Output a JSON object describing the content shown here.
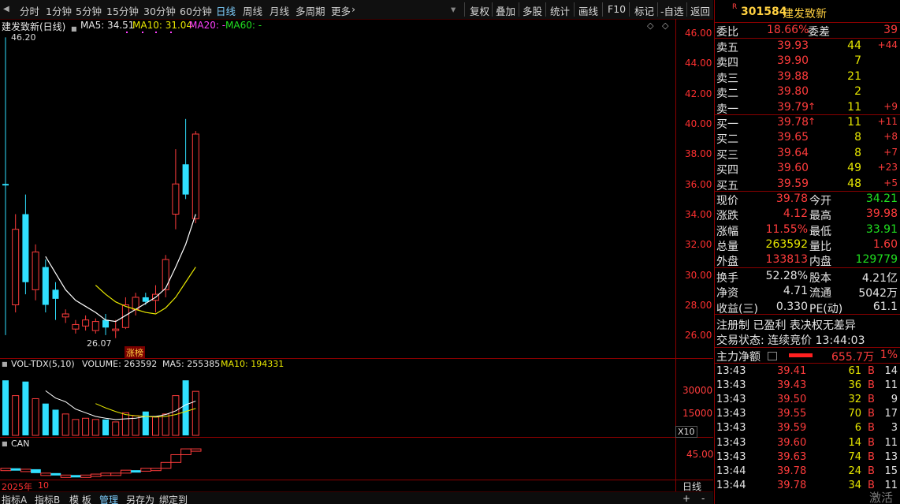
{
  "toolbar": {
    "left_tabs": [
      "分时",
      "1分钟",
      "5分钟",
      "15分钟",
      "30分钟",
      "60分钟",
      "日线",
      "周线",
      "月线",
      "多周期",
      "更多"
    ],
    "active_tab": "日线",
    "right_buttons": [
      "复权",
      "叠加",
      "多股",
      "统计",
      "画线",
      "F10",
      "标记",
      "-自选",
      "返回"
    ]
  },
  "main_chart": {
    "title": "建发致新(日线)",
    "ma5": "MA5: 34.51",
    "ma10": "MA10: 31.04",
    "ma20": "MA20: -",
    "ma60": "MA60: -",
    "high_label": "46.20",
    "low_label": "26.07",
    "badge": "涨榜",
    "y_ticks": [
      "46.00",
      "44.00",
      "42.00",
      "40.00",
      "38.00",
      "36.00",
      "34.00",
      "32.00",
      "30.00",
      "28.00",
      "26.00"
    ]
  },
  "volume_chart": {
    "title": "VOL-TDX(5,10)",
    "volume": "VOLUME: 263592",
    "ma5": "MA5: 255385",
    "ma10": "MA10: 194331",
    "y_ticks": [
      "30000",
      "15000"
    ],
    "unit": "X10"
  },
  "can_chart": {
    "title": "CAN",
    "y_tick": "45.00"
  },
  "time_axis": {
    "year": "2025年",
    "month": "10",
    "period": "日线"
  },
  "bottom_tabs": [
    "指标A",
    "指标B",
    "模 板",
    "管理",
    "另存为",
    "绑定到"
  ],
  "bottom_right": [
    "+",
    "-"
  ],
  "stock": {
    "badge": "R",
    "code": "301584",
    "name": "建发致新"
  },
  "order_book": {
    "wei_bi_label": "委比",
    "wei_bi": "18.66%",
    "wei_cha_label": "委差",
    "wei_cha": "39",
    "sells": [
      {
        "label": "卖五",
        "price": "39.93",
        "vol": "44",
        "chg": "+44"
      },
      {
        "label": "卖四",
        "price": "39.90",
        "vol": "7",
        "chg": ""
      },
      {
        "label": "卖三",
        "price": "39.88",
        "vol": "21",
        "chg": ""
      },
      {
        "label": "卖二",
        "price": "39.80",
        "vol": "2",
        "chg": ""
      },
      {
        "label": "卖一",
        "price": "39.79",
        "vol": "11",
        "chg": "+9",
        "arrow": "↑"
      }
    ],
    "buys": [
      {
        "label": "买一",
        "price": "39.78",
        "vol": "11",
        "chg": "+11",
        "arrow": "↑"
      },
      {
        "label": "买二",
        "price": "39.65",
        "vol": "8",
        "chg": "+8"
      },
      {
        "label": "买三",
        "price": "39.64",
        "vol": "8",
        "chg": "+7"
      },
      {
        "label": "买四",
        "price": "39.60",
        "vol": "49",
        "chg": "+23"
      },
      {
        "label": "买五",
        "price": "39.59",
        "vol": "48",
        "chg": "+5"
      }
    ]
  },
  "quote": [
    {
      "l1": "现价",
      "v1": "39.78",
      "l2": "今开",
      "v2": "34.21",
      "c2": "grn"
    },
    {
      "l1": "涨跌",
      "v1": "4.12",
      "l2": "最高",
      "v2": "39.98",
      "c2": "red"
    },
    {
      "l1": "涨幅",
      "v1": "11.55%",
      "l2": "最低",
      "v2": "33.91",
      "c2": "grn"
    },
    {
      "l1": "总量",
      "v1": "263592",
      "l2": "量比",
      "v2": "1.60",
      "c2": "red",
      "c1": "yel"
    },
    {
      "l1": "外盘",
      "v1": "133813",
      "l2": "内盘",
      "v2": "129779",
      "c2": "grn"
    }
  ],
  "fundamentals": [
    {
      "l1": "换手",
      "v1": "52.28%",
      "l2": "股本",
      "v2": "4.21亿"
    },
    {
      "l1": "净资",
      "v1": "4.71",
      "l2": "流通",
      "v2": "5042万"
    },
    {
      "l1": "收益(三)",
      "v1": "0.330",
      "l2": "PE(动)",
      "v2": "61.1"
    }
  ],
  "info_line": "注册制 已盈利 表决权无差异",
  "trade_status": "交易状态: 连续竞价 13:44:03",
  "main_flow": {
    "label": "主力净额",
    "value": "655.7万",
    "pct": "1%"
  },
  "ticks": [
    {
      "t": "13:43",
      "p": "39.41",
      "v": "61",
      "s": "B",
      "n": "14"
    },
    {
      "t": "13:43",
      "p": "39.43",
      "v": "36",
      "s": "B",
      "n": "11"
    },
    {
      "t": "13:43",
      "p": "39.50",
      "v": "32",
      "s": "B",
      "n": "9"
    },
    {
      "t": "13:43",
      "p": "39.55",
      "v": "70",
      "s": "B",
      "n": "17"
    },
    {
      "t": "13:43",
      "p": "39.59",
      "v": "6",
      "s": "B",
      "n": "3"
    },
    {
      "t": "13:43",
      "p": "39.60",
      "v": "14",
      "s": "B",
      "n": "11"
    },
    {
      "t": "13:43",
      "p": "39.63",
      "v": "74",
      "s": "B",
      "n": "13"
    },
    {
      "t": "13:44",
      "p": "39.78",
      "v": "24",
      "s": "B",
      "n": "15"
    },
    {
      "t": "13:44",
      "p": "39.78",
      "v": "34",
      "s": "B",
      "n": "11"
    }
  ],
  "watermark": "激活",
  "colors": {
    "up": "#ff3c3c",
    "down": "#30e0ff",
    "ma5": "#ffffff",
    "ma10": "#e8e800",
    "panel_border": "#8a0000"
  },
  "chart_data": {
    "type": "candlestick",
    "candles": [
      {
        "o": 36.4,
        "h": 46.2,
        "l": 26.5,
        "c": 36.5,
        "dir": "down"
      },
      {
        "o": 33.5,
        "h": 34.5,
        "l": 28.0,
        "c": 28.5,
        "dir": "up"
      },
      {
        "o": 34.5,
        "h": 35.8,
        "l": 29.2,
        "c": 30.0,
        "dir": "down"
      },
      {
        "o": 32.0,
        "h": 32.5,
        "l": 28.8,
        "c": 29.5,
        "dir": "up"
      },
      {
        "o": 31.0,
        "h": 31.5,
        "l": 28.0,
        "c": 28.5,
        "dir": "down"
      },
      {
        "o": 29.5,
        "h": 30.0,
        "l": 27.5,
        "c": 28.9,
        "dir": "down"
      },
      {
        "o": 27.7,
        "h": 28.2,
        "l": 27.3,
        "c": 27.9,
        "dir": "up"
      },
      {
        "o": 27.2,
        "h": 27.5,
        "l": 26.6,
        "c": 26.9,
        "dir": "up"
      },
      {
        "o": 27.5,
        "h": 27.8,
        "l": 26.8,
        "c": 27.1,
        "dir": "up"
      },
      {
        "o": 26.8,
        "h": 27.6,
        "l": 26.6,
        "c": 27.4,
        "dir": "up"
      },
      {
        "o": 27.5,
        "h": 27.9,
        "l": 26.5,
        "c": 27.0,
        "dir": "down"
      },
      {
        "o": 26.8,
        "h": 27.5,
        "l": 26.3,
        "c": 26.9,
        "dir": "up"
      },
      {
        "o": 27.0,
        "h": 29.0,
        "l": 26.9,
        "c": 28.5,
        "dir": "up"
      },
      {
        "o": 28.2,
        "h": 29.3,
        "l": 27.8,
        "c": 29.0,
        "dir": "up"
      },
      {
        "o": 29.0,
        "h": 29.3,
        "l": 28.5,
        "c": 28.7,
        "dir": "down"
      },
      {
        "o": 28.8,
        "h": 29.8,
        "l": 28.0,
        "c": 29.2,
        "dir": "up"
      },
      {
        "o": 29.5,
        "h": 31.8,
        "l": 29.0,
        "c": 31.5,
        "dir": "up"
      },
      {
        "o": 34.5,
        "h": 38.8,
        "l": 33.5,
        "c": 36.5,
        "dir": "up"
      },
      {
        "o": 37.8,
        "h": 40.8,
        "l": 35.5,
        "c": 35.8,
        "dir": "down"
      },
      {
        "o": 34.2,
        "h": 40.0,
        "l": 33.9,
        "c": 39.8,
        "dir": "up"
      }
    ],
    "ma5": [
      null,
      null,
      null,
      null,
      31.7,
      30.6,
      29.5,
      28.8,
      28.4,
      28.0,
      27.5,
      27.4,
      27.8,
      28.2,
      28.6,
      29.0,
      29.6,
      31.0,
      32.5,
      34.5
    ],
    "ma10": [
      null,
      null,
      null,
      null,
      null,
      null,
      null,
      null,
      null,
      29.8,
      29.2,
      28.7,
      28.4,
      28.2,
      28.0,
      27.9,
      28.3,
      29.0,
      30.0,
      31.0
    ],
    "volume": [
      9000,
      6500,
      8800,
      6000,
      5200,
      4200,
      3500,
      2600,
      2800,
      2600,
      2600,
      2200,
      3700,
      3200,
      3900,
      3000,
      3500,
      6500,
      9000,
      7200
    ],
    "can": [
      43.6,
      43.4,
      43.5,
      43.1,
      43.1,
      42.9,
      42.9,
      42.8,
      42.9,
      43.0,
      43.1,
      43.1,
      43.4,
      43.3,
      43.6,
      43.6,
      44.2,
      45.0,
      45.6,
      45.6
    ],
    "ylim": [
      25.5,
      47.0
    ]
  }
}
